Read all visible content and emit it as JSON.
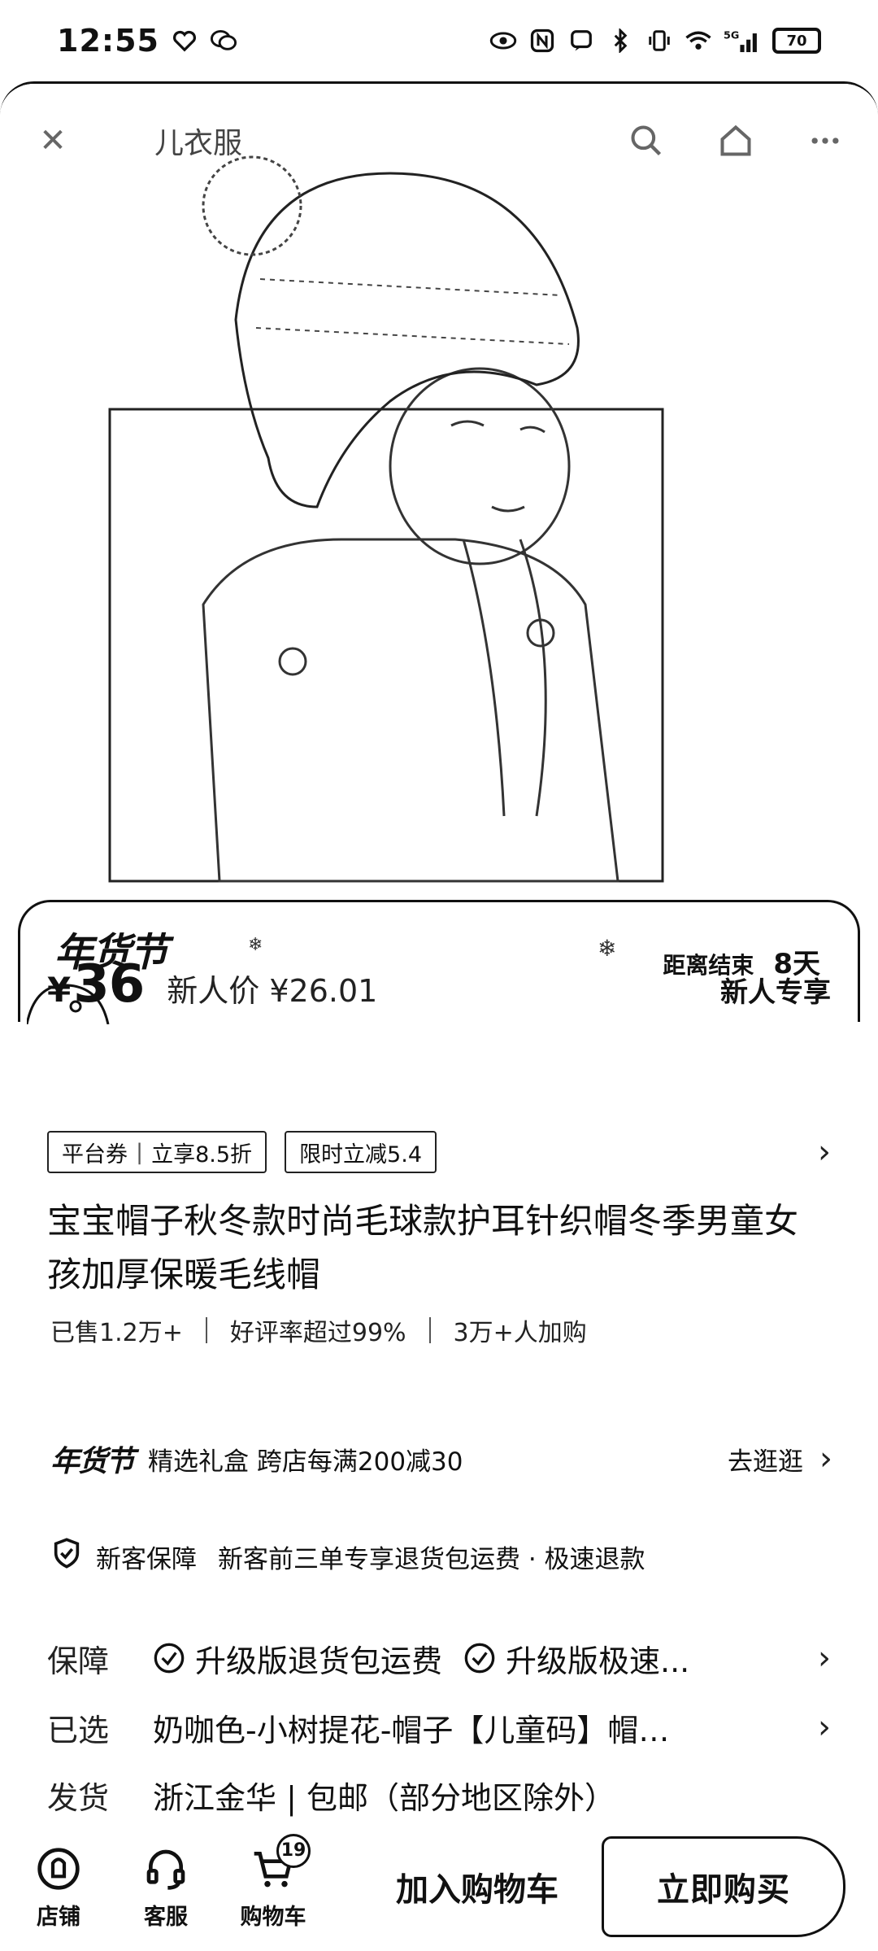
{
  "status_bar": {
    "time": "12:55",
    "network": "5G",
    "battery": "70"
  },
  "nav": {
    "title": "儿衣服",
    "close_icon": "close-icon",
    "search_icon": "search-icon",
    "home_icon": "home-icon",
    "more_icon": "more-icon"
  },
  "banner": {
    "logo": "年货节",
    "countdown_label": "距离结束",
    "countdown_value": "8天"
  },
  "price": {
    "currency": "¥",
    "amount": "36",
    "newcomer_price": "新人价 ¥26.01",
    "newcomer_tag": "新人专享"
  },
  "coupons": {
    "platform_label": "平台券",
    "platform_discount": "立享8.5折",
    "limited": "限时立减5.4"
  },
  "product": {
    "title": "宝宝帽子秋冬款时尚毛球款护耳针织帽冬季男童女孩加厚保暖毛线帽",
    "sold": "已售1.2万+",
    "rating": "好评率超过99%",
    "added": "3万+人加购"
  },
  "promo": {
    "logo": "年货节",
    "text": "精选礼盒 跨店每满200减30",
    "link": "去逛逛"
  },
  "guarantee": {
    "title": "新客保障",
    "text": "新客前三单专享退货包运费 · 极速退款"
  },
  "attributes": {
    "protection_key": "保障",
    "protection_item1": "升级版退货包运费",
    "protection_item2": "升级版极速...",
    "selected_key": "已选",
    "selected_value": "奶咖色-小树提花-帽子【儿童码】帽…",
    "shipping_key": "发货",
    "shipping_value": "浙江金华 | 包邮（部分地区除外）"
  },
  "bottom_bar": {
    "store": "店铺",
    "service": "客服",
    "cart": "购物车",
    "cart_count": "19",
    "add_to_cart": "加入购物车",
    "buy_now": "立即购买"
  }
}
